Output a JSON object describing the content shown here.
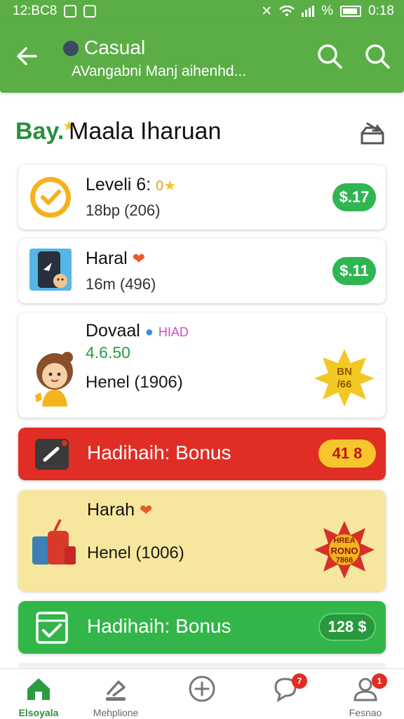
{
  "status_bar": {
    "time_left": "12:BC8",
    "battery_text": "%",
    "time_right": "0:18"
  },
  "header": {
    "title": "Casual",
    "subtitle": "AVangabni Manj aihenhd..."
  },
  "page": {
    "logo": "Bay.",
    "title": "Maala Iharuan"
  },
  "cards": [
    {
      "name": "Leveli 6:",
      "tag": "0",
      "sub": "18bp (206)",
      "pill": "$.17"
    },
    {
      "name": "Haral",
      "sub": "16m (496)",
      "pill": "$.11"
    },
    {
      "name": "Dovaal",
      "tag": "HIAD",
      "price": "4.6.50",
      "sub": "Henel (1906)",
      "burst_line1": "BN",
      "burst_line2": "/66"
    },
    {
      "name": "Hadihaih: Bonus",
      "pill": "41 8"
    },
    {
      "name": "Harah",
      "sub": "Henel (1006)",
      "burst_line1": "HREA",
      "burst_line2": "RONO",
      "burst_line3": "7866"
    },
    {
      "name": "Hadihaih: Bonus",
      "pill": "128 $"
    }
  ],
  "colors": {
    "brand_green": "#5aae45",
    "pill_green": "#2fb552",
    "bonus_red": "#e02d25",
    "bonus_yellow": "#f7e79e",
    "bonus_green": "#32b64a"
  },
  "bottom_nav": {
    "items": [
      {
        "label": "Elsoyala",
        "icon": "home-icon",
        "active": true
      },
      {
        "label": "Mehplione",
        "icon": "gavel-icon"
      },
      {
        "label": "",
        "icon": "plus-circle-icon"
      },
      {
        "label": "",
        "icon": "chat-heart-icon",
        "badge": "7"
      },
      {
        "label": "Fesnao",
        "icon": "user-icon",
        "badge": "1"
      }
    ]
  }
}
